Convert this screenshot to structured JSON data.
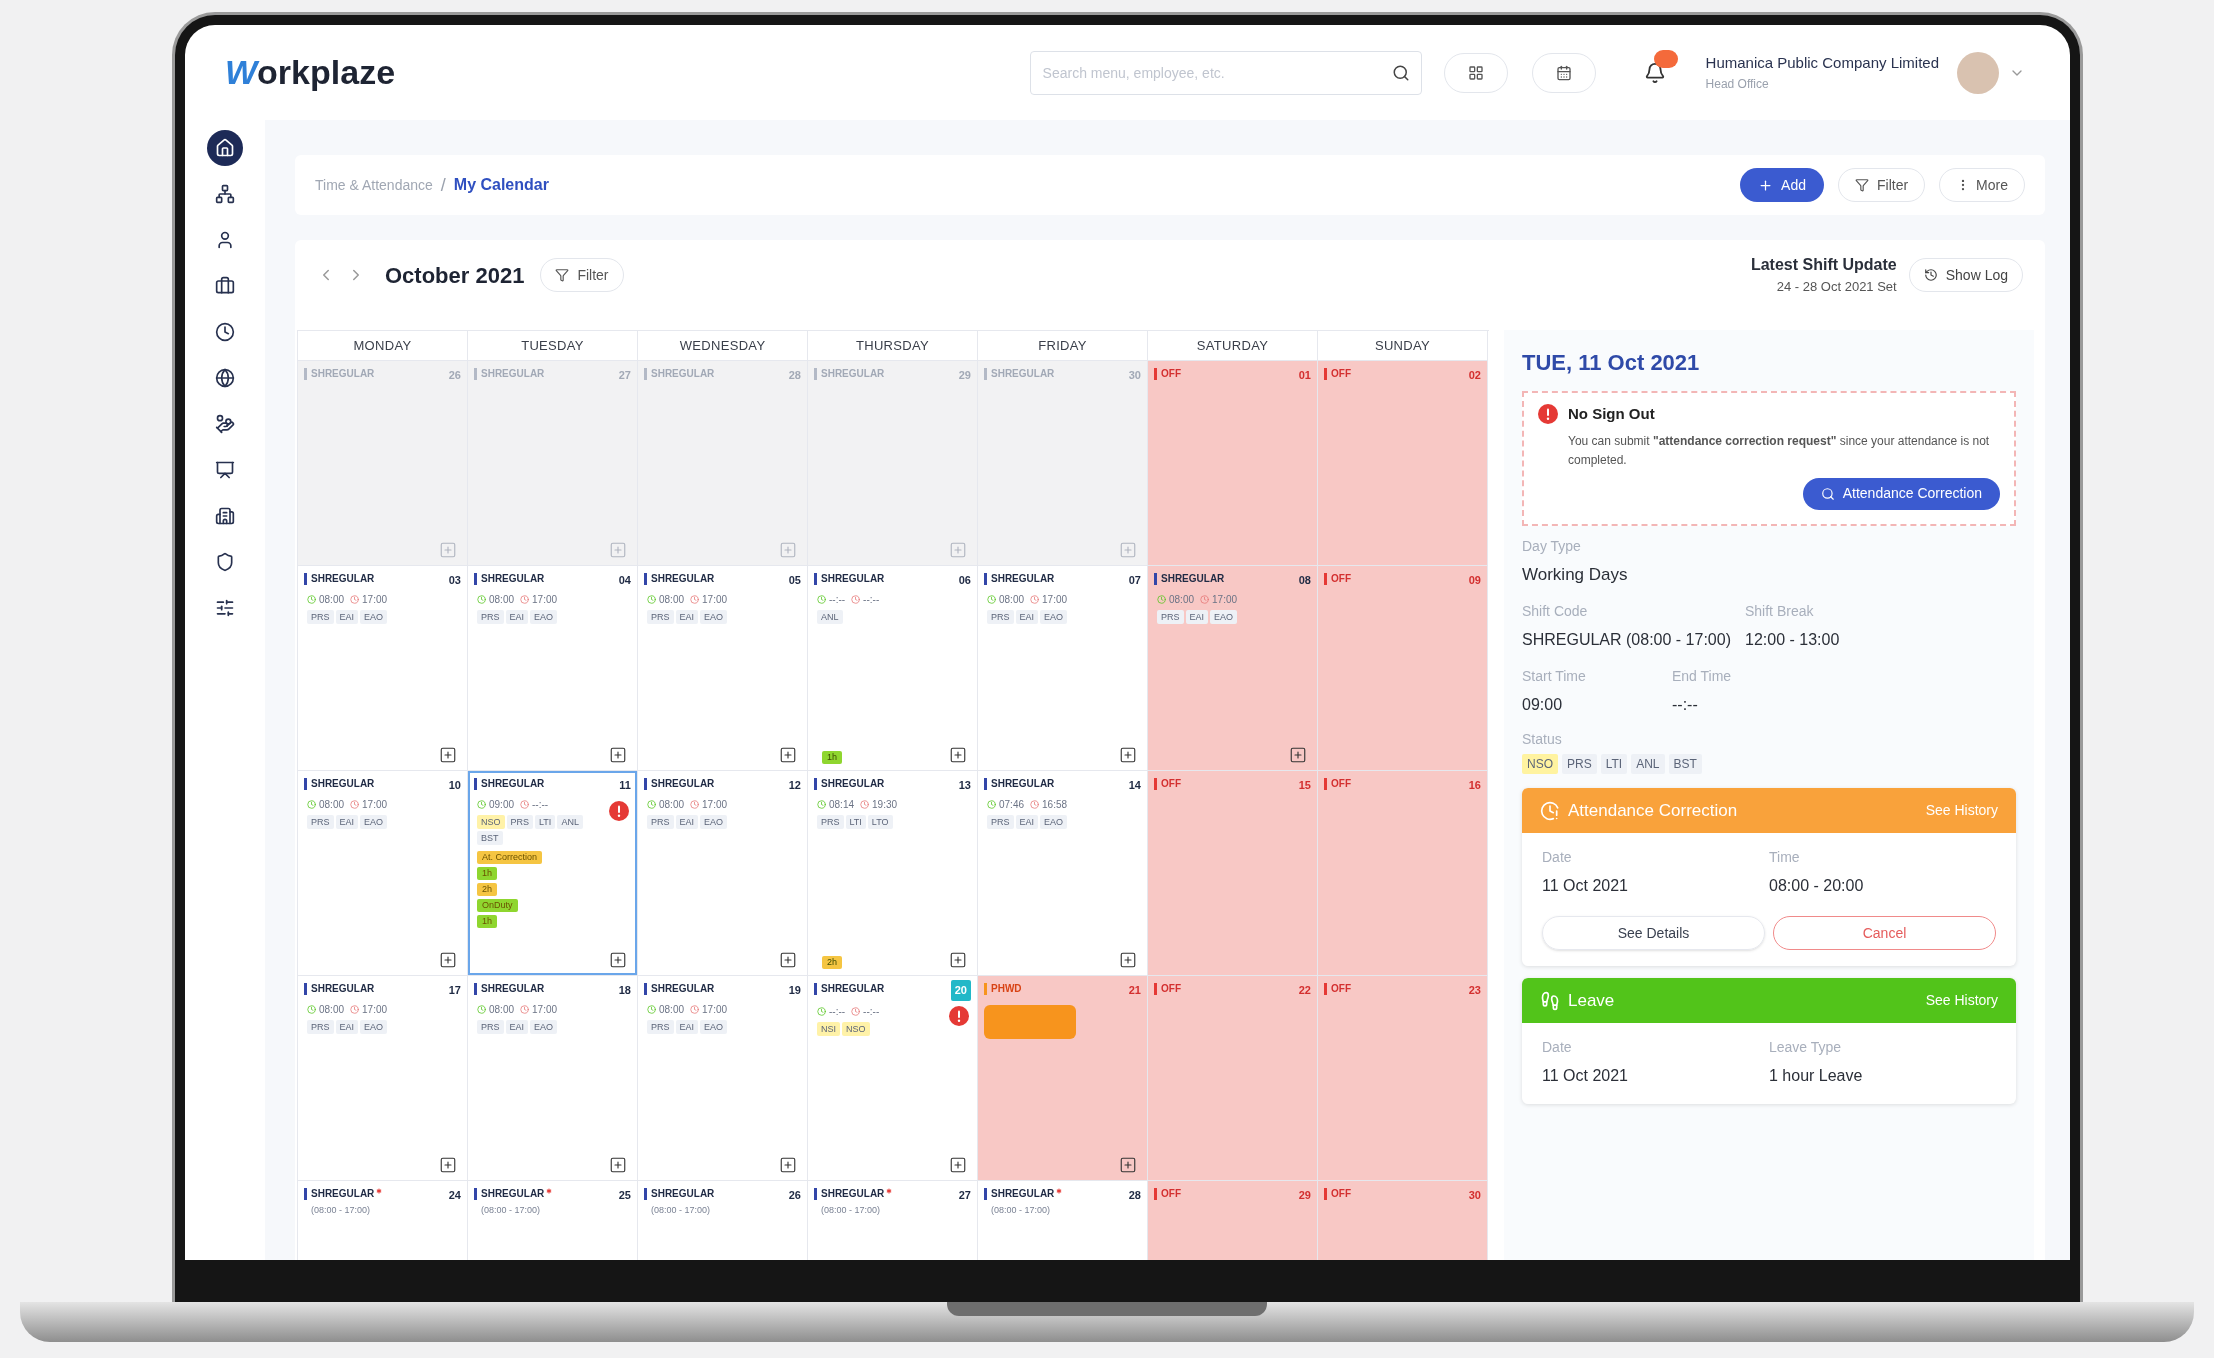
{
  "header": {
    "logo": "Workplaze",
    "search": {
      "placeholder": "Search menu, employee, etc."
    },
    "notifications": {
      "unread": true
    },
    "company": "Humanica Public Company Limited",
    "branch": "Head Office"
  },
  "sidebar": {
    "items": [
      {
        "selected": true
      },
      {
        "selected": false
      },
      {
        "selected": false
      },
      {
        "selected": false
      },
      {
        "selected": false
      },
      {
        "selected": false
      },
      {
        "selected": false
      },
      {
        "selected": false
      },
      {
        "selected": false
      },
      {
        "selected": false
      },
      {
        "selected": false
      }
    ]
  },
  "breadcrumb_separator": "/",
  "breadcrumb": [
    {
      "label": "Time & Attendance",
      "current": false
    },
    {
      "label": "My Calendar",
      "current": true
    }
  ],
  "actions": {
    "add": "Add",
    "filter": "Filter",
    "more": "More"
  },
  "calendar": {
    "month": "October 2021",
    "filter": "Filter",
    "shift_update": {
      "title": "Latest Shift Update",
      "range": "24 - 28 Oct 2021 Set",
      "button": "Show Log"
    },
    "days": [
      {
        "label": "MONDAY"
      },
      {
        "label": "TUESDAY"
      },
      {
        "label": "WEDNESDAY"
      },
      {
        "label": "THURSDAY"
      },
      {
        "label": "FRIDAY"
      },
      {
        "label": "SATURDAY"
      },
      {
        "label": "SUNDAY"
      }
    ],
    "weeks": [
      {
        "cells": [
          {
            "day": "26",
            "shift": "SHREGULAR",
            "kind": "other_month",
            "shaded": false,
            "can_add": true
          },
          {
            "day": "27",
            "shift": "SHREGULAR",
            "kind": "other_month",
            "shaded": false,
            "can_add": true
          },
          {
            "day": "28",
            "shift": "SHREGULAR",
            "kind": "other_month",
            "shaded": false,
            "can_add": true
          },
          {
            "day": "29",
            "shift": "SHREGULAR",
            "kind": "other_month",
            "shaded": false,
            "can_add": true
          },
          {
            "day": "30",
            "shift": "SHREGULAR",
            "kind": "other_month",
            "shaded": false,
            "can_add": true
          },
          {
            "day": "01",
            "shift": "OFF",
            "kind": "off",
            "shaded": true,
            "can_add": false
          },
          {
            "day": "02",
            "shift": "OFF",
            "kind": "off",
            "shaded": true,
            "can_add": false
          }
        ]
      },
      {
        "cells": [
          {
            "day": "03",
            "shift": "SHREGULAR",
            "kind": "work",
            "shaded": false,
            "can_add": true,
            "in": "08:00",
            "out": "17:00",
            "tags": [
              {
                "label": "PRS",
                "color": "#eef1f6"
              },
              {
                "label": "EAI",
                "color": "#eef1f6"
              },
              {
                "label": "EAO",
                "color": "#eef1f6"
              }
            ]
          },
          {
            "day": "04",
            "shift": "SHREGULAR",
            "kind": "work",
            "shaded": false,
            "can_add": true,
            "in": "08:00",
            "out": "17:00",
            "tags": [
              {
                "label": "PRS",
                "color": "#eef1f6"
              },
              {
                "label": "EAI",
                "color": "#eef1f6"
              },
              {
                "label": "EAO",
                "color": "#eef1f6"
              }
            ]
          },
          {
            "day": "05",
            "shift": "SHREGULAR",
            "kind": "work",
            "shaded": false,
            "can_add": true,
            "in": "08:00",
            "out": "17:00",
            "tags": [
              {
                "label": "PRS",
                "color": "#eef1f6"
              },
              {
                "label": "EAI",
                "color": "#eef1f6"
              },
              {
                "label": "EAO",
                "color": "#eef1f6"
              }
            ]
          },
          {
            "day": "06",
            "shift": "SHREGULAR",
            "kind": "work",
            "shaded": false,
            "can_add": true,
            "in": "--:--",
            "out": "--:--",
            "tags": [
              {
                "label": "ANL",
                "color": "#eef1f6"
              }
            ],
            "bottom_events": [
              {
                "label": "1h",
                "color": "#8fd62f"
              }
            ]
          },
          {
            "day": "07",
            "shift": "SHREGULAR",
            "kind": "work",
            "shaded": false,
            "can_add": true,
            "in": "08:00",
            "out": "17:00",
            "tags": [
              {
                "label": "PRS",
                "color": "#eef1f6"
              },
              {
                "label": "EAI",
                "color": "#eef1f6"
              },
              {
                "label": "EAO",
                "color": "#eef1f6"
              }
            ]
          },
          {
            "day": "08",
            "shift": "SHREGULAR",
            "kind": "work",
            "shaded": true,
            "can_add": true,
            "in": "08:00",
            "out": "17:00",
            "tags": [
              {
                "label": "PRS",
                "color": "#eef1f6"
              },
              {
                "label": "EAI",
                "color": "#eef1f6"
              },
              {
                "label": "EAO",
                "color": "#eef1f6"
              }
            ]
          },
          {
            "day": "09",
            "shift": "OFF",
            "kind": "off",
            "shaded": true,
            "can_add": false
          }
        ]
      },
      {
        "cells": [
          {
            "day": "10",
            "shift": "SHREGULAR",
            "kind": "work",
            "shaded": false,
            "can_add": true,
            "in": "08:00",
            "out": "17:00",
            "tags": [
              {
                "label": "PRS",
                "color": "#eef1f6"
              },
              {
                "label": "EAI",
                "color": "#eef1f6"
              },
              {
                "label": "EAO",
                "color": "#eef1f6"
              }
            ]
          },
          {
            "day": "11",
            "shift": "SHREGULAR",
            "kind": "work",
            "shaded": false,
            "can_add": true,
            "selected": true,
            "alert": true,
            "in": "09:00",
            "out": "--:--",
            "tags": [
              {
                "label": "NSO",
                "color": "#fff2a8"
              },
              {
                "label": "PRS",
                "color": "#eef1f6"
              },
              {
                "label": "LTI",
                "color": "#eef1f6"
              },
              {
                "label": "ANL",
                "color": "#eef1f6"
              },
              {
                "label": "BST",
                "color": "#eef1f6"
              }
            ],
            "events": [
              {
                "label": "At. Correction",
                "color": "#f5c542"
              },
              {
                "label": "1h",
                "color": "#8fd62f"
              },
              {
                "label": "2h",
                "color": "#f5c542"
              },
              {
                "label": "OnDuty",
                "color": "#8fd62f"
              },
              {
                "label": "1h",
                "color": "#8fd62f"
              }
            ]
          },
          {
            "day": "12",
            "shift": "SHREGULAR",
            "kind": "work",
            "shaded": false,
            "can_add": true,
            "in": "08:00",
            "out": "17:00",
            "tags": [
              {
                "label": "PRS",
                "color": "#eef1f6"
              },
              {
                "label": "EAI",
                "color": "#eef1f6"
              },
              {
                "label": "EAO",
                "color": "#eef1f6"
              }
            ]
          },
          {
            "day": "13",
            "shift": "SHREGULAR",
            "kind": "work",
            "shaded": false,
            "can_add": true,
            "in": "08:14",
            "out": "19:30",
            "tags": [
              {
                "label": "PRS",
                "color": "#eef1f6"
              },
              {
                "label": "LTI",
                "color": "#eef1f6"
              },
              {
                "label": "LTO",
                "color": "#eef1f6"
              }
            ],
            "bottom_events": [
              {
                "label": "2h",
                "color": "#f5c542"
              }
            ]
          },
          {
            "day": "14",
            "shift": "SHREGULAR",
            "kind": "work",
            "shaded": false,
            "can_add": true,
            "in": "07:46",
            "out": "16:58",
            "tags": [
              {
                "label": "PRS",
                "color": "#eef1f6"
              },
              {
                "label": "EAI",
                "color": "#eef1f6"
              },
              {
                "label": "EAO",
                "color": "#eef1f6"
              }
            ]
          },
          {
            "day": "15",
            "shift": "OFF",
            "kind": "off",
            "shaded": true,
            "can_add": false
          },
          {
            "day": "16",
            "shift": "OFF",
            "kind": "off",
            "shaded": true,
            "can_add": false
          }
        ]
      },
      {
        "cells": [
          {
            "day": "17",
            "shift": "SHREGULAR",
            "kind": "work",
            "shaded": false,
            "can_add": true,
            "in": "08:00",
            "out": "17:00",
            "tags": [
              {
                "label": "PRS",
                "color": "#eef1f6"
              },
              {
                "label": "EAI",
                "color": "#eef1f6"
              },
              {
                "label": "EAO",
                "color": "#eef1f6"
              }
            ]
          },
          {
            "day": "18",
            "shift": "SHREGULAR",
            "kind": "work",
            "shaded": false,
            "can_add": true,
            "in": "08:00",
            "out": "17:00",
            "tags": [
              {
                "label": "PRS",
                "color": "#eef1f6"
              },
              {
                "label": "EAI",
                "color": "#eef1f6"
              },
              {
                "label": "EAO",
                "color": "#eef1f6"
              }
            ]
          },
          {
            "day": "19",
            "shift": "SHREGULAR",
            "kind": "work",
            "shaded": false,
            "can_add": true,
            "in": "08:00",
            "out": "17:00",
            "tags": [
              {
                "label": "PRS",
                "color": "#eef1f6"
              },
              {
                "label": "EAI",
                "color": "#eef1f6"
              },
              {
                "label": "EAO",
                "color": "#eef1f6"
              }
            ]
          },
          {
            "day": "20",
            "shift": "SHREGULAR",
            "kind": "work",
            "shaded": false,
            "can_add": true,
            "today": true,
            "alert": true,
            "in": "--:--",
            "out": "--:--",
            "tags": [
              {
                "label": "NSI",
                "color": "#fff2a8"
              },
              {
                "label": "NSO",
                "color": "#fff2a8"
              }
            ]
          },
          {
            "day": "21",
            "shift": "PHWD",
            "kind": "holiday",
            "shaded": true,
            "can_add": true,
            "holiday_bar": {
              "color": "#f7941d"
            }
          },
          {
            "day": "22",
            "shift": "OFF",
            "kind": "off",
            "shaded": true,
            "can_add": false
          },
          {
            "day": "23",
            "shift": "OFF",
            "kind": "off",
            "shaded": true,
            "can_add": false
          }
        ]
      },
      {
        "cells": [
          {
            "day": "24",
            "shift": "SHREGULAR",
            "kind": "work",
            "shaded": false,
            "can_add": false,
            "starred": true,
            "range": "(08:00 - 17:00)"
          },
          {
            "day": "25",
            "shift": "SHREGULAR",
            "kind": "work",
            "shaded": false,
            "can_add": false,
            "starred": true,
            "range": "(08:00 - 17:00)"
          },
          {
            "day": "26",
            "shift": "SHREGULAR",
            "kind": "work",
            "shaded": false,
            "can_add": false,
            "starred": false,
            "range": "(08:00 - 17:00)"
          },
          {
            "day": "27",
            "shift": "SHREGULAR",
            "kind": "work",
            "shaded": false,
            "can_add": false,
            "starred": true,
            "range": "(08:00 - 17:00)"
          },
          {
            "day": "28",
            "shift": "SHREGULAR",
            "kind": "work",
            "shaded": false,
            "can_add": false,
            "starred": true,
            "range": "(08:00 - 17:00)"
          },
          {
            "day": "29",
            "shift": "OFF",
            "kind": "off",
            "shaded": true,
            "can_add": false
          },
          {
            "day": "30",
            "shift": "OFF",
            "kind": "off",
            "shaded": true,
            "can_add": false
          }
        ]
      }
    ]
  },
  "detail": {
    "date": "TUE, 11 Oct 2021",
    "alert": {
      "title": "No Sign Out",
      "message": "You can submit **\"attendance correction request\"** since your attendance is not completed.",
      "button": "Attendance Correction"
    },
    "day_type": {
      "label": "Day Type",
      "value": "Working Days"
    },
    "shift_code": {
      "label": "Shift Code",
      "value": "SHREGULAR (08:00 - 17:00)"
    },
    "shift_break": {
      "label": "Shift Break",
      "value": "12:00 - 13:00"
    },
    "start_time": {
      "label": "Start Time",
      "value": "09:00"
    },
    "end_time": {
      "label": "End Time",
      "value": "--:--"
    },
    "status": {
      "label": "Status",
      "tags": [
        {
          "label": "NSO",
          "color": "#fff3a0"
        },
        {
          "label": "PRS",
          "color": "#eef1f6"
        },
        {
          "label": "LTI",
          "color": "#eef1f6"
        },
        {
          "label": "ANL",
          "color": "#eef1f6"
        },
        {
          "label": "BST",
          "color": "#eef1f6"
        }
      ]
    },
    "cards": [
      {
        "kind": "correction",
        "title": "Attendance Correction",
        "link": "See History",
        "color": "#f9a23b",
        "fields": [
          {
            "label": "Date",
            "value": "11 Oct 2021"
          },
          {
            "label": "Time",
            "value": "08:00 - 20:00"
          }
        ],
        "buttons": [
          {
            "label": "See Details",
            "kind": "default"
          },
          {
            "label": "Cancel",
            "kind": "danger"
          }
        ]
      },
      {
        "kind": "leave",
        "title": "Leave",
        "link": "See History",
        "color": "#52c41a",
        "fields": [
          {
            "label": "Date",
            "value": "11 Oct 2021"
          },
          {
            "label": "Leave Type",
            "value": "1 hour Leave"
          }
        ]
      }
    ]
  }
}
